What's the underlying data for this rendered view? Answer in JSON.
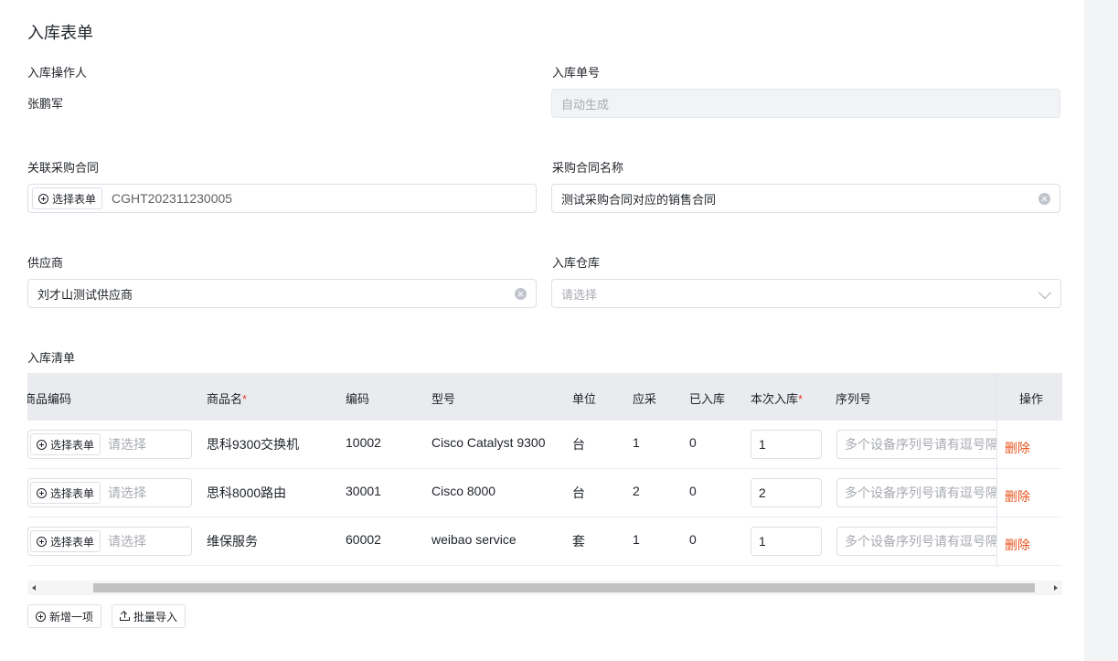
{
  "form": {
    "title": "入库表单",
    "operator_label": "入库操作人",
    "operator_value": "张鹏军",
    "order_no_label": "入库单号",
    "order_no_placeholder": "自动生成",
    "contract_label": "关联采购合同",
    "contract_select_btn": "选择表单",
    "contract_value": "CGHT202311230005",
    "contract_name_label": "采购合同名称",
    "contract_name_value": "测试采购合同对应的销售合同",
    "supplier_label": "供应商",
    "supplier_value": "刘才山测试供应商",
    "warehouse_label": "入库仓库",
    "warehouse_placeholder": "请选择"
  },
  "inventory": {
    "section_label": "入库清单",
    "columns": {
      "product_code": "商品编码",
      "product_name": "商品名",
      "code": "编码",
      "model": "型号",
      "unit": "单位",
      "expected": "应采",
      "received": "已入库",
      "this_time": "本次入库",
      "serial": "序列号",
      "action": "操作"
    },
    "required_mark": "*",
    "select_btn": "选择表单",
    "select_placeholder": "请选择",
    "serial_placeholder": "多个设备序列号请有逗号隔开",
    "delete_label": "删除",
    "rows": [
      {
        "name": "思科9300交换机",
        "code": "10002",
        "model": "Cisco Catalyst 9300",
        "unit": "台",
        "expected": "1",
        "received": "0",
        "qty": "1"
      },
      {
        "name": "思科8000路由",
        "code": "30001",
        "model": "Cisco 8000",
        "unit": "台",
        "expected": "2",
        "received": "0",
        "qty": "2"
      },
      {
        "name": "维保服务",
        "code": "60002",
        "model": "weibao service",
        "unit": "套",
        "expected": "1",
        "received": "0",
        "qty": "1"
      }
    ]
  },
  "footer": {
    "add_item_btn": "新增一项",
    "batch_import_btn": "批量导入"
  }
}
